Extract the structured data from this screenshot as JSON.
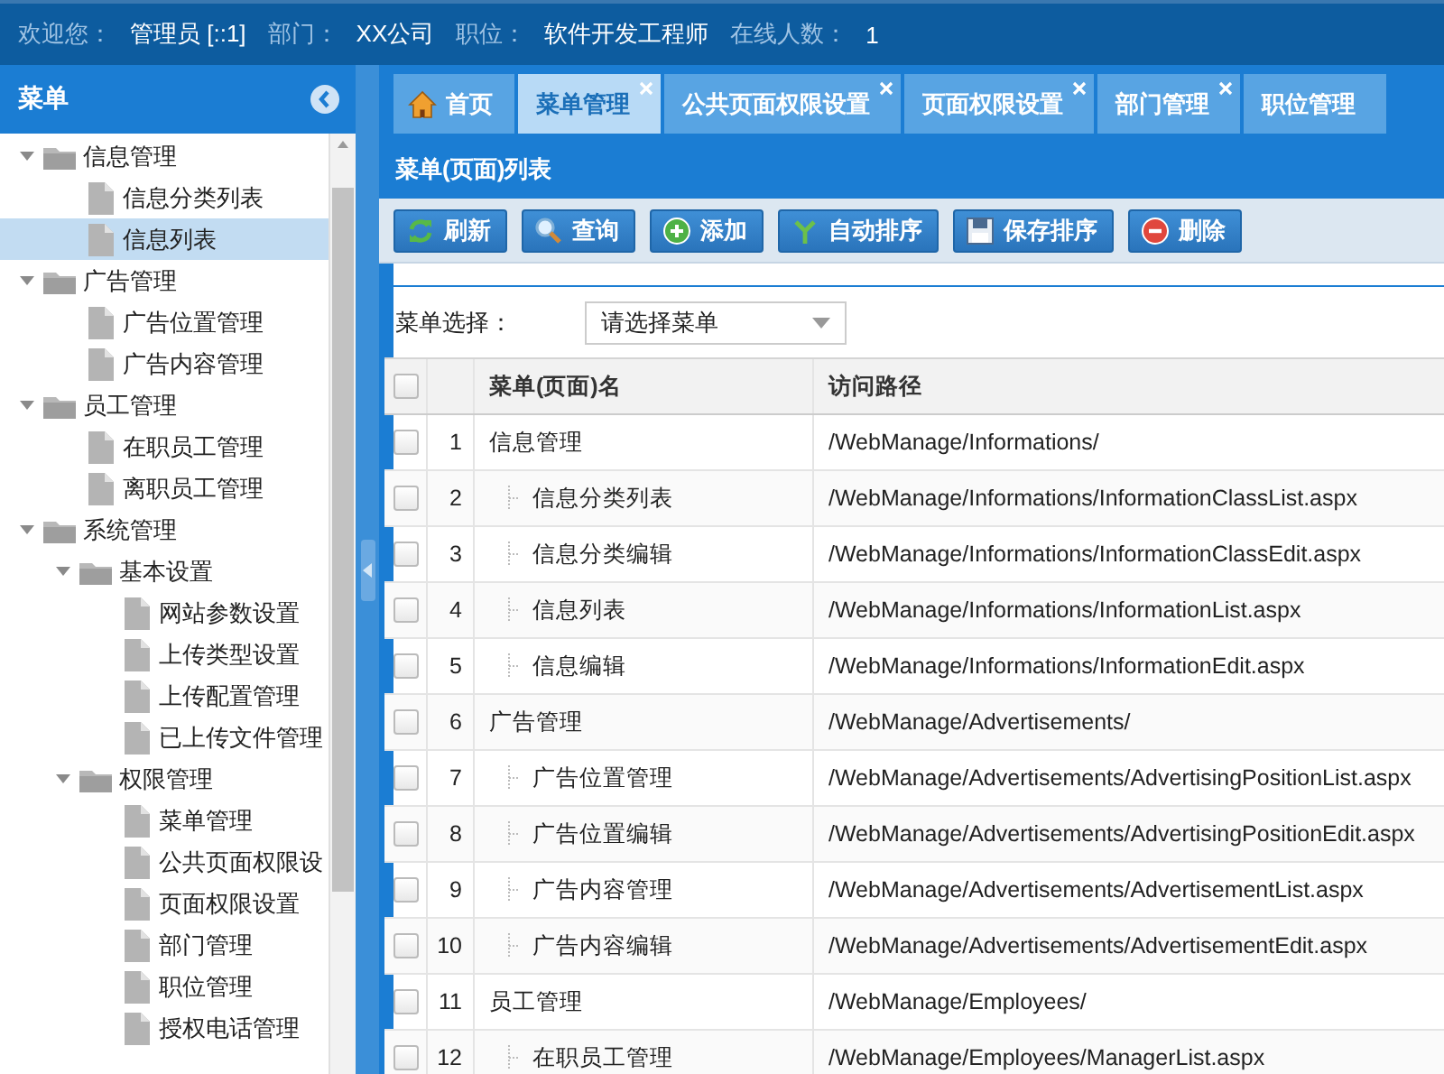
{
  "user_bar": [
    {
      "label": "欢迎您：",
      "value": "管理员 [::1]"
    },
    {
      "label": "部门：",
      "value": "XX公司"
    },
    {
      "label": "职位：",
      "value": "软件开发工程师"
    },
    {
      "label": "在线人数：",
      "value": "1"
    }
  ],
  "sidebar": {
    "title": "菜单",
    "items": [
      {
        "label": "信息管理",
        "kind": "folder",
        "expanded": true,
        "selected": false,
        "children": [
          {
            "label": "信息分类列表",
            "kind": "page",
            "selected": false
          },
          {
            "label": "信息列表",
            "kind": "page",
            "selected": true
          }
        ]
      },
      {
        "label": "广告管理",
        "kind": "folder",
        "expanded": true,
        "selected": false,
        "children": [
          {
            "label": "广告位置管理",
            "kind": "page",
            "selected": false
          },
          {
            "label": "广告内容管理",
            "kind": "page",
            "selected": false
          }
        ]
      },
      {
        "label": "员工管理",
        "kind": "folder",
        "expanded": true,
        "selected": false,
        "children": [
          {
            "label": "在职员工管理",
            "kind": "page",
            "selected": false
          },
          {
            "label": "离职员工管理",
            "kind": "page",
            "selected": false
          }
        ]
      },
      {
        "label": "系统管理",
        "kind": "folder",
        "expanded": true,
        "selected": false,
        "children": [
          {
            "label": "基本设置",
            "kind": "folder",
            "expanded": true,
            "selected": false,
            "children": [
              {
                "label": "网站参数设置",
                "kind": "page",
                "selected": false
              },
              {
                "label": "上传类型设置",
                "kind": "page",
                "selected": false
              },
              {
                "label": "上传配置管理",
                "kind": "page",
                "selected": false
              },
              {
                "label": "已上传文件管理",
                "kind": "page",
                "selected": false
              }
            ]
          },
          {
            "label": "权限管理",
            "kind": "folder",
            "expanded": true,
            "selected": false,
            "children": [
              {
                "label": "菜单管理",
                "kind": "page",
                "selected": false
              },
              {
                "label": "公共页面权限设",
                "kind": "page",
                "selected": false
              },
              {
                "label": "页面权限设置",
                "kind": "page",
                "selected": false
              },
              {
                "label": "部门管理",
                "kind": "page",
                "selected": false
              },
              {
                "label": "职位管理",
                "kind": "page",
                "selected": false
              },
              {
                "label": "授权电话管理",
                "kind": "page",
                "selected": false
              }
            ]
          }
        ]
      }
    ]
  },
  "tabs": [
    {
      "label": "首页",
      "kind": "home",
      "selected": false,
      "closable": false
    },
    {
      "label": "菜单管理",
      "kind": "page",
      "selected": true,
      "closable": true
    },
    {
      "label": "公共页面权限设置",
      "kind": "page",
      "selected": false,
      "closable": true
    },
    {
      "label": "页面权限设置",
      "kind": "page",
      "selected": false,
      "closable": true
    },
    {
      "label": "部门管理",
      "kind": "page",
      "selected": false,
      "closable": true
    },
    {
      "label": "职位管理",
      "kind": "page",
      "selected": false,
      "closable": false
    }
  ],
  "panel": {
    "title": "菜单(页面)列表",
    "toolbar": [
      {
        "label": "刷新",
        "kind": "refresh"
      },
      {
        "label": "查询",
        "kind": "search"
      },
      {
        "label": "添加",
        "kind": "add"
      },
      {
        "label": "自动排序",
        "kind": "sort"
      },
      {
        "label": "保存排序",
        "kind": "save"
      },
      {
        "label": "删除",
        "kind": "delete"
      }
    ],
    "filter": {
      "label": "菜单选择：",
      "value": "请选择菜单"
    },
    "table": {
      "header_checked": false,
      "columns": [
        "菜单(页面)名",
        "访问路径"
      ],
      "rows": [
        {
          "number": "1",
          "name": "信息管理",
          "path": "/WebManage/Informations/",
          "checked": false,
          "children": [
            {
              "number": "2",
              "name": "信息分类列表",
              "path": "/WebManage/Informations/InformationClassList.aspx",
              "checked": false
            },
            {
              "number": "3",
              "name": "信息分类编辑",
              "path": "/WebManage/Informations/InformationClassEdit.aspx",
              "checked": false
            },
            {
              "number": "4",
              "name": "信息列表",
              "path": "/WebManage/Informations/InformationList.aspx",
              "checked": false
            },
            {
              "number": "5",
              "name": "信息编辑",
              "path": "/WebManage/Informations/InformationEdit.aspx",
              "checked": false
            }
          ]
        },
        {
          "number": "6",
          "name": "广告管理",
          "path": "/WebManage/Advertisements/",
          "checked": false,
          "children": [
            {
              "number": "7",
              "name": "广告位置管理",
              "path": "/WebManage/Advertisements/AdvertisingPositionList.aspx",
              "checked": false
            },
            {
              "number": "8",
              "name": "广告位置编辑",
              "path": "/WebManage/Advertisements/AdvertisingPositionEdit.aspx",
              "checked": false
            },
            {
              "number": "9",
              "name": "广告内容管理",
              "path": "/WebManage/Advertisements/AdvertisementList.aspx",
              "checked": false
            },
            {
              "number": "10",
              "name": "广告内容编辑",
              "path": "/WebManage/Advertisements/AdvertisementEdit.aspx",
              "checked": false
            }
          ]
        },
        {
          "number": "11",
          "name": "员工管理",
          "path": "/WebManage/Employees/",
          "checked": false,
          "children": [
            {
              "number": "12",
              "name": "在职员工管理",
              "path": "/WebManage/Employees/ManagerList.aspx",
              "checked": false
            }
          ]
        }
      ]
    }
  }
}
